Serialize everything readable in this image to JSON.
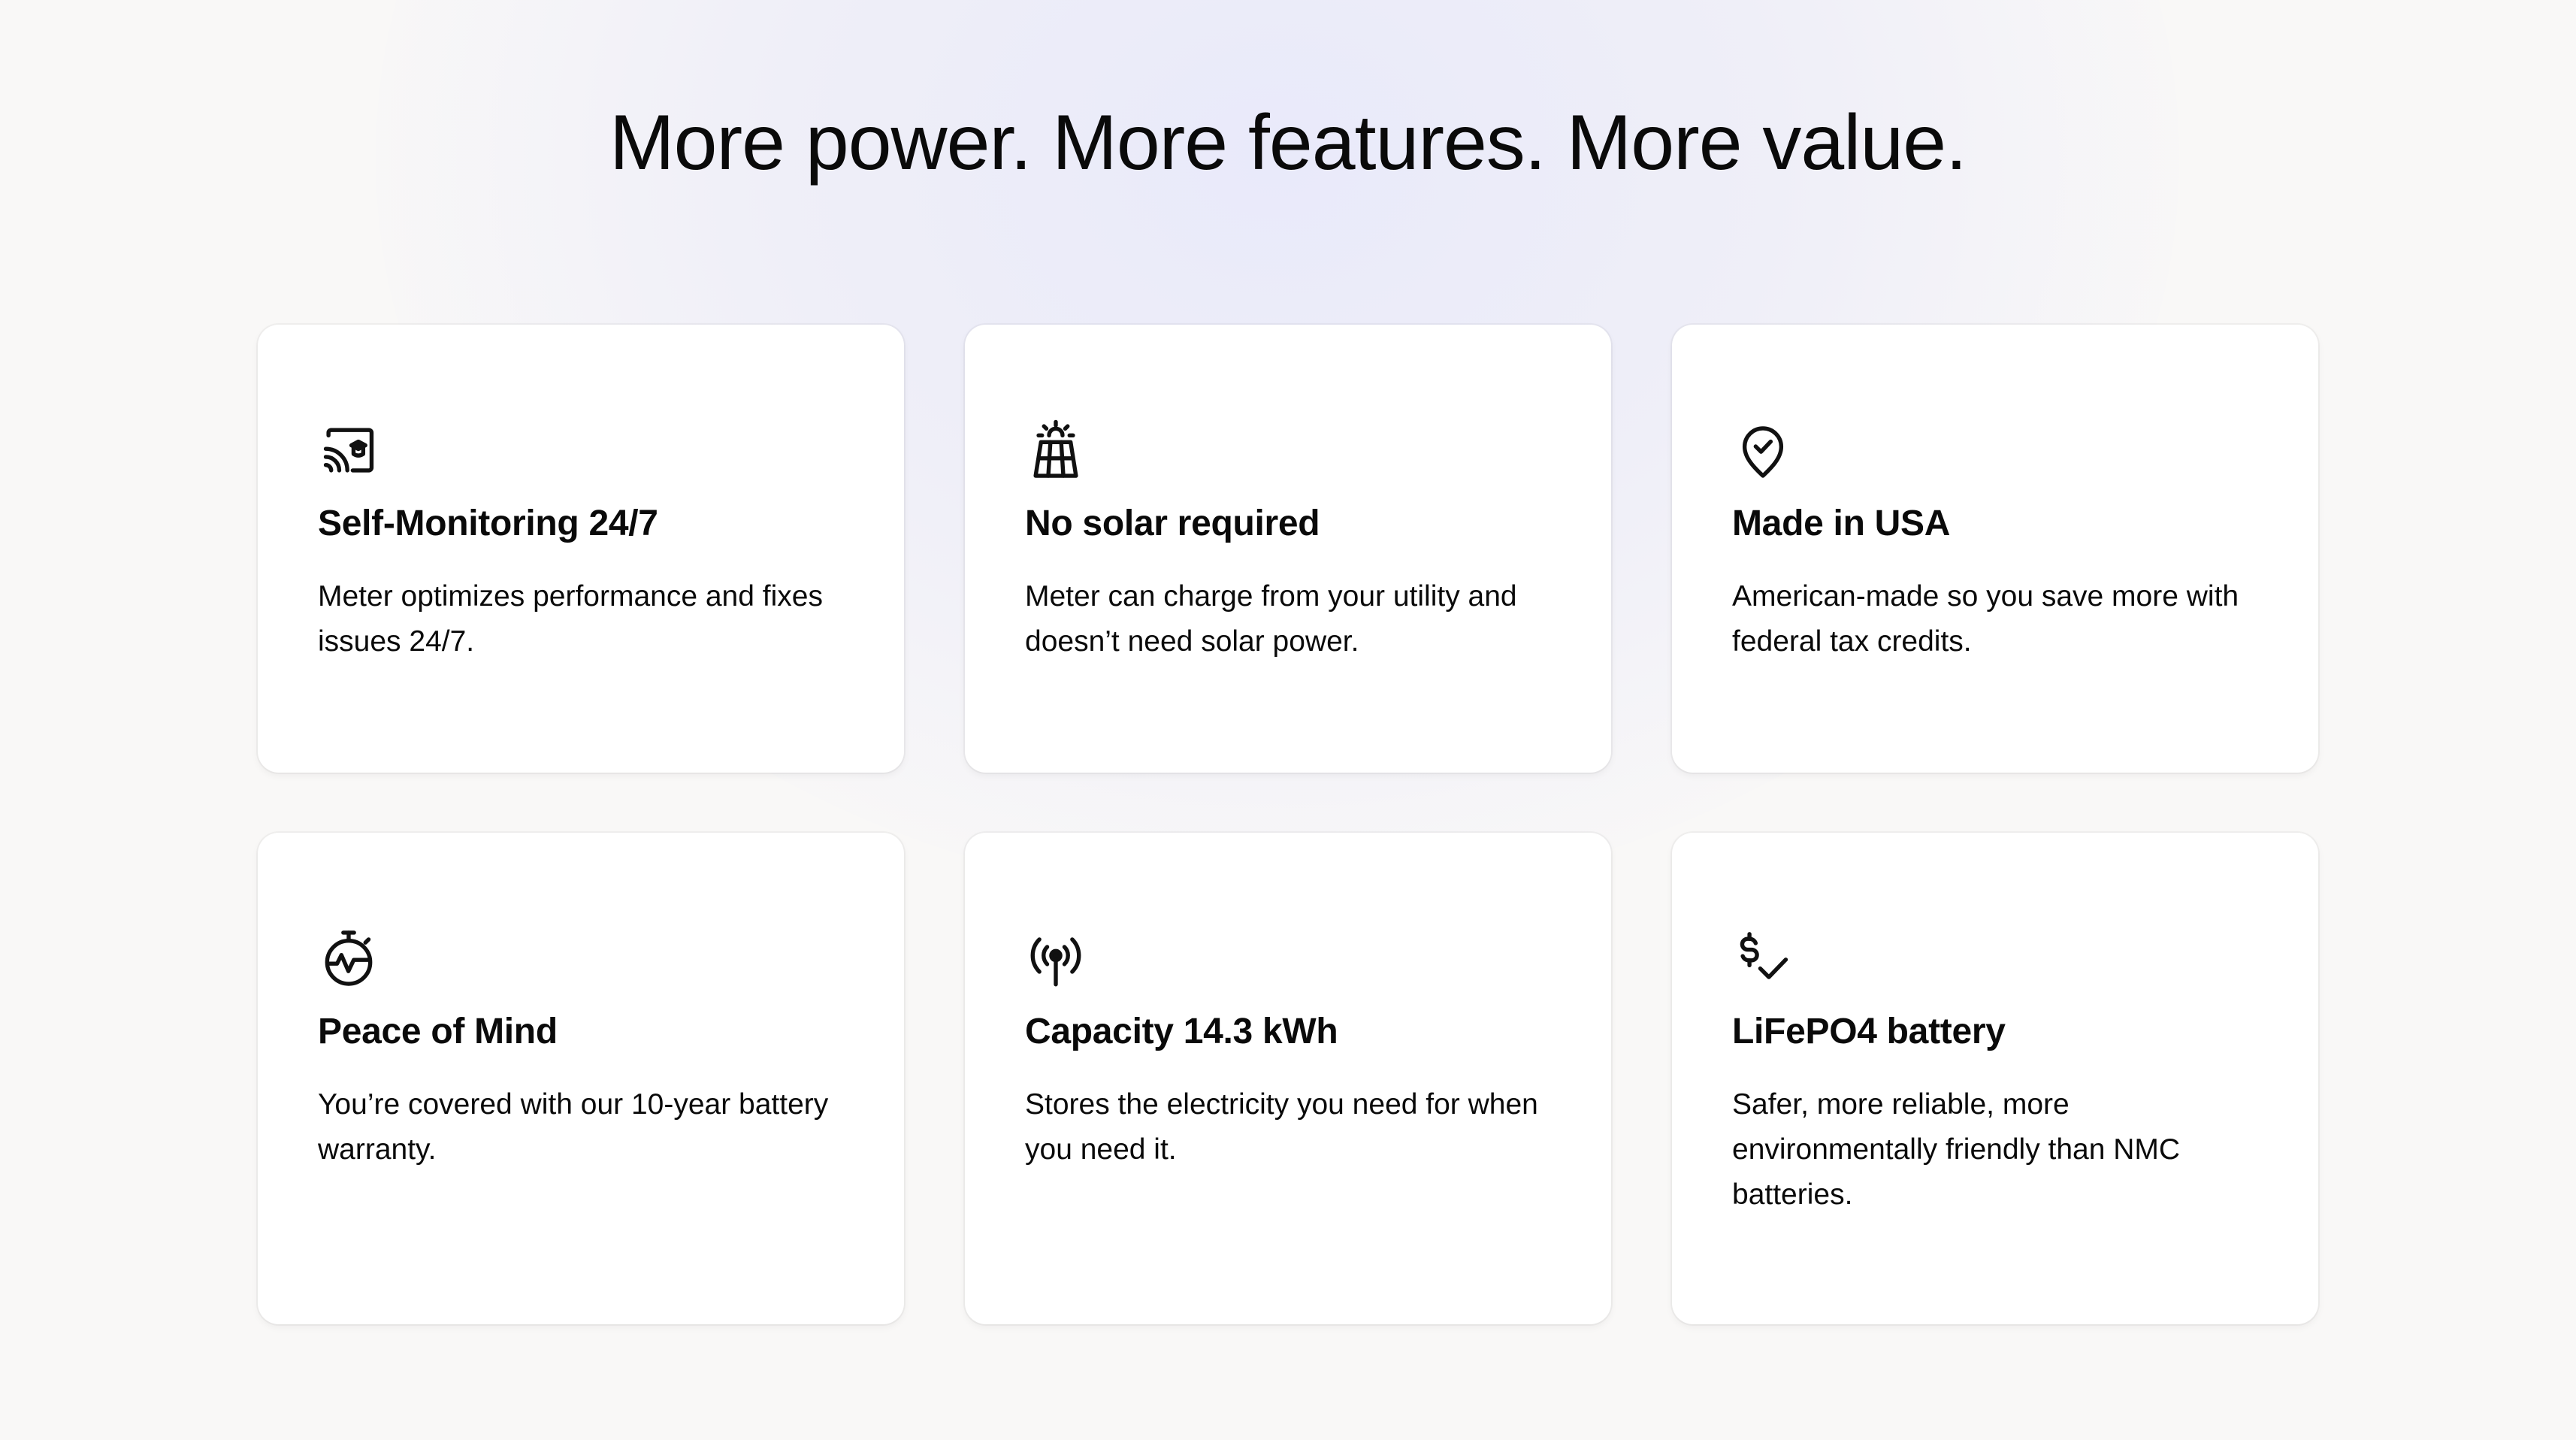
{
  "headline": "More power. More features. More value.",
  "features": [
    {
      "icon": "cast-monitor-icon",
      "title": "Self-Monitoring 24/7",
      "description": "Meter optimizes performance and fixes issues 24/7."
    },
    {
      "icon": "solar-panel-icon",
      "title": "No solar required",
      "description": "Meter can charge from your utility and doesn’t need solar power."
    },
    {
      "icon": "location-check-icon",
      "title": "Made in USA",
      "description": "American-made so you save more with federal tax credits."
    },
    {
      "icon": "stopwatch-pulse-icon",
      "title": "Peace of Mind",
      "description": "You’re covered with our 10-year battery warranty."
    },
    {
      "icon": "broadcast-antenna-icon",
      "title": "Capacity 14.3 kWh",
      "description": "Stores the electricity you need for when you need it."
    },
    {
      "icon": "dollar-check-icon",
      "title": "LiFePO4 battery",
      "description": "Safer, more reliable, more environmentally friendly than NMC batteries."
    }
  ]
}
